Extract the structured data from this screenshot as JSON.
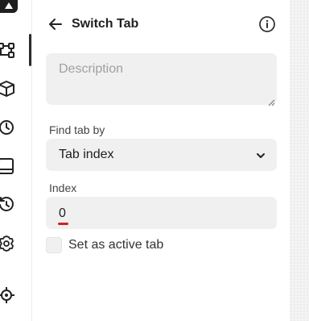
{
  "header": {
    "title": "Switch Tab"
  },
  "description": {
    "placeholder": "Description",
    "value": ""
  },
  "find_tab": {
    "label": "Find tab by",
    "selected": "Tab index"
  },
  "index": {
    "label": "Index",
    "value": "0"
  },
  "active_tab": {
    "label": "Set as active tab",
    "checked": false
  },
  "sidebar": {
    "items": [
      {
        "icon": "workflow-icon",
        "active": true
      },
      {
        "icon": "package-icon"
      },
      {
        "icon": "clock-icon"
      },
      {
        "icon": "panel-bottom-icon"
      },
      {
        "icon": "history-icon"
      },
      {
        "icon": "gear-icon"
      },
      {
        "icon": "crosshair-icon"
      }
    ]
  }
}
